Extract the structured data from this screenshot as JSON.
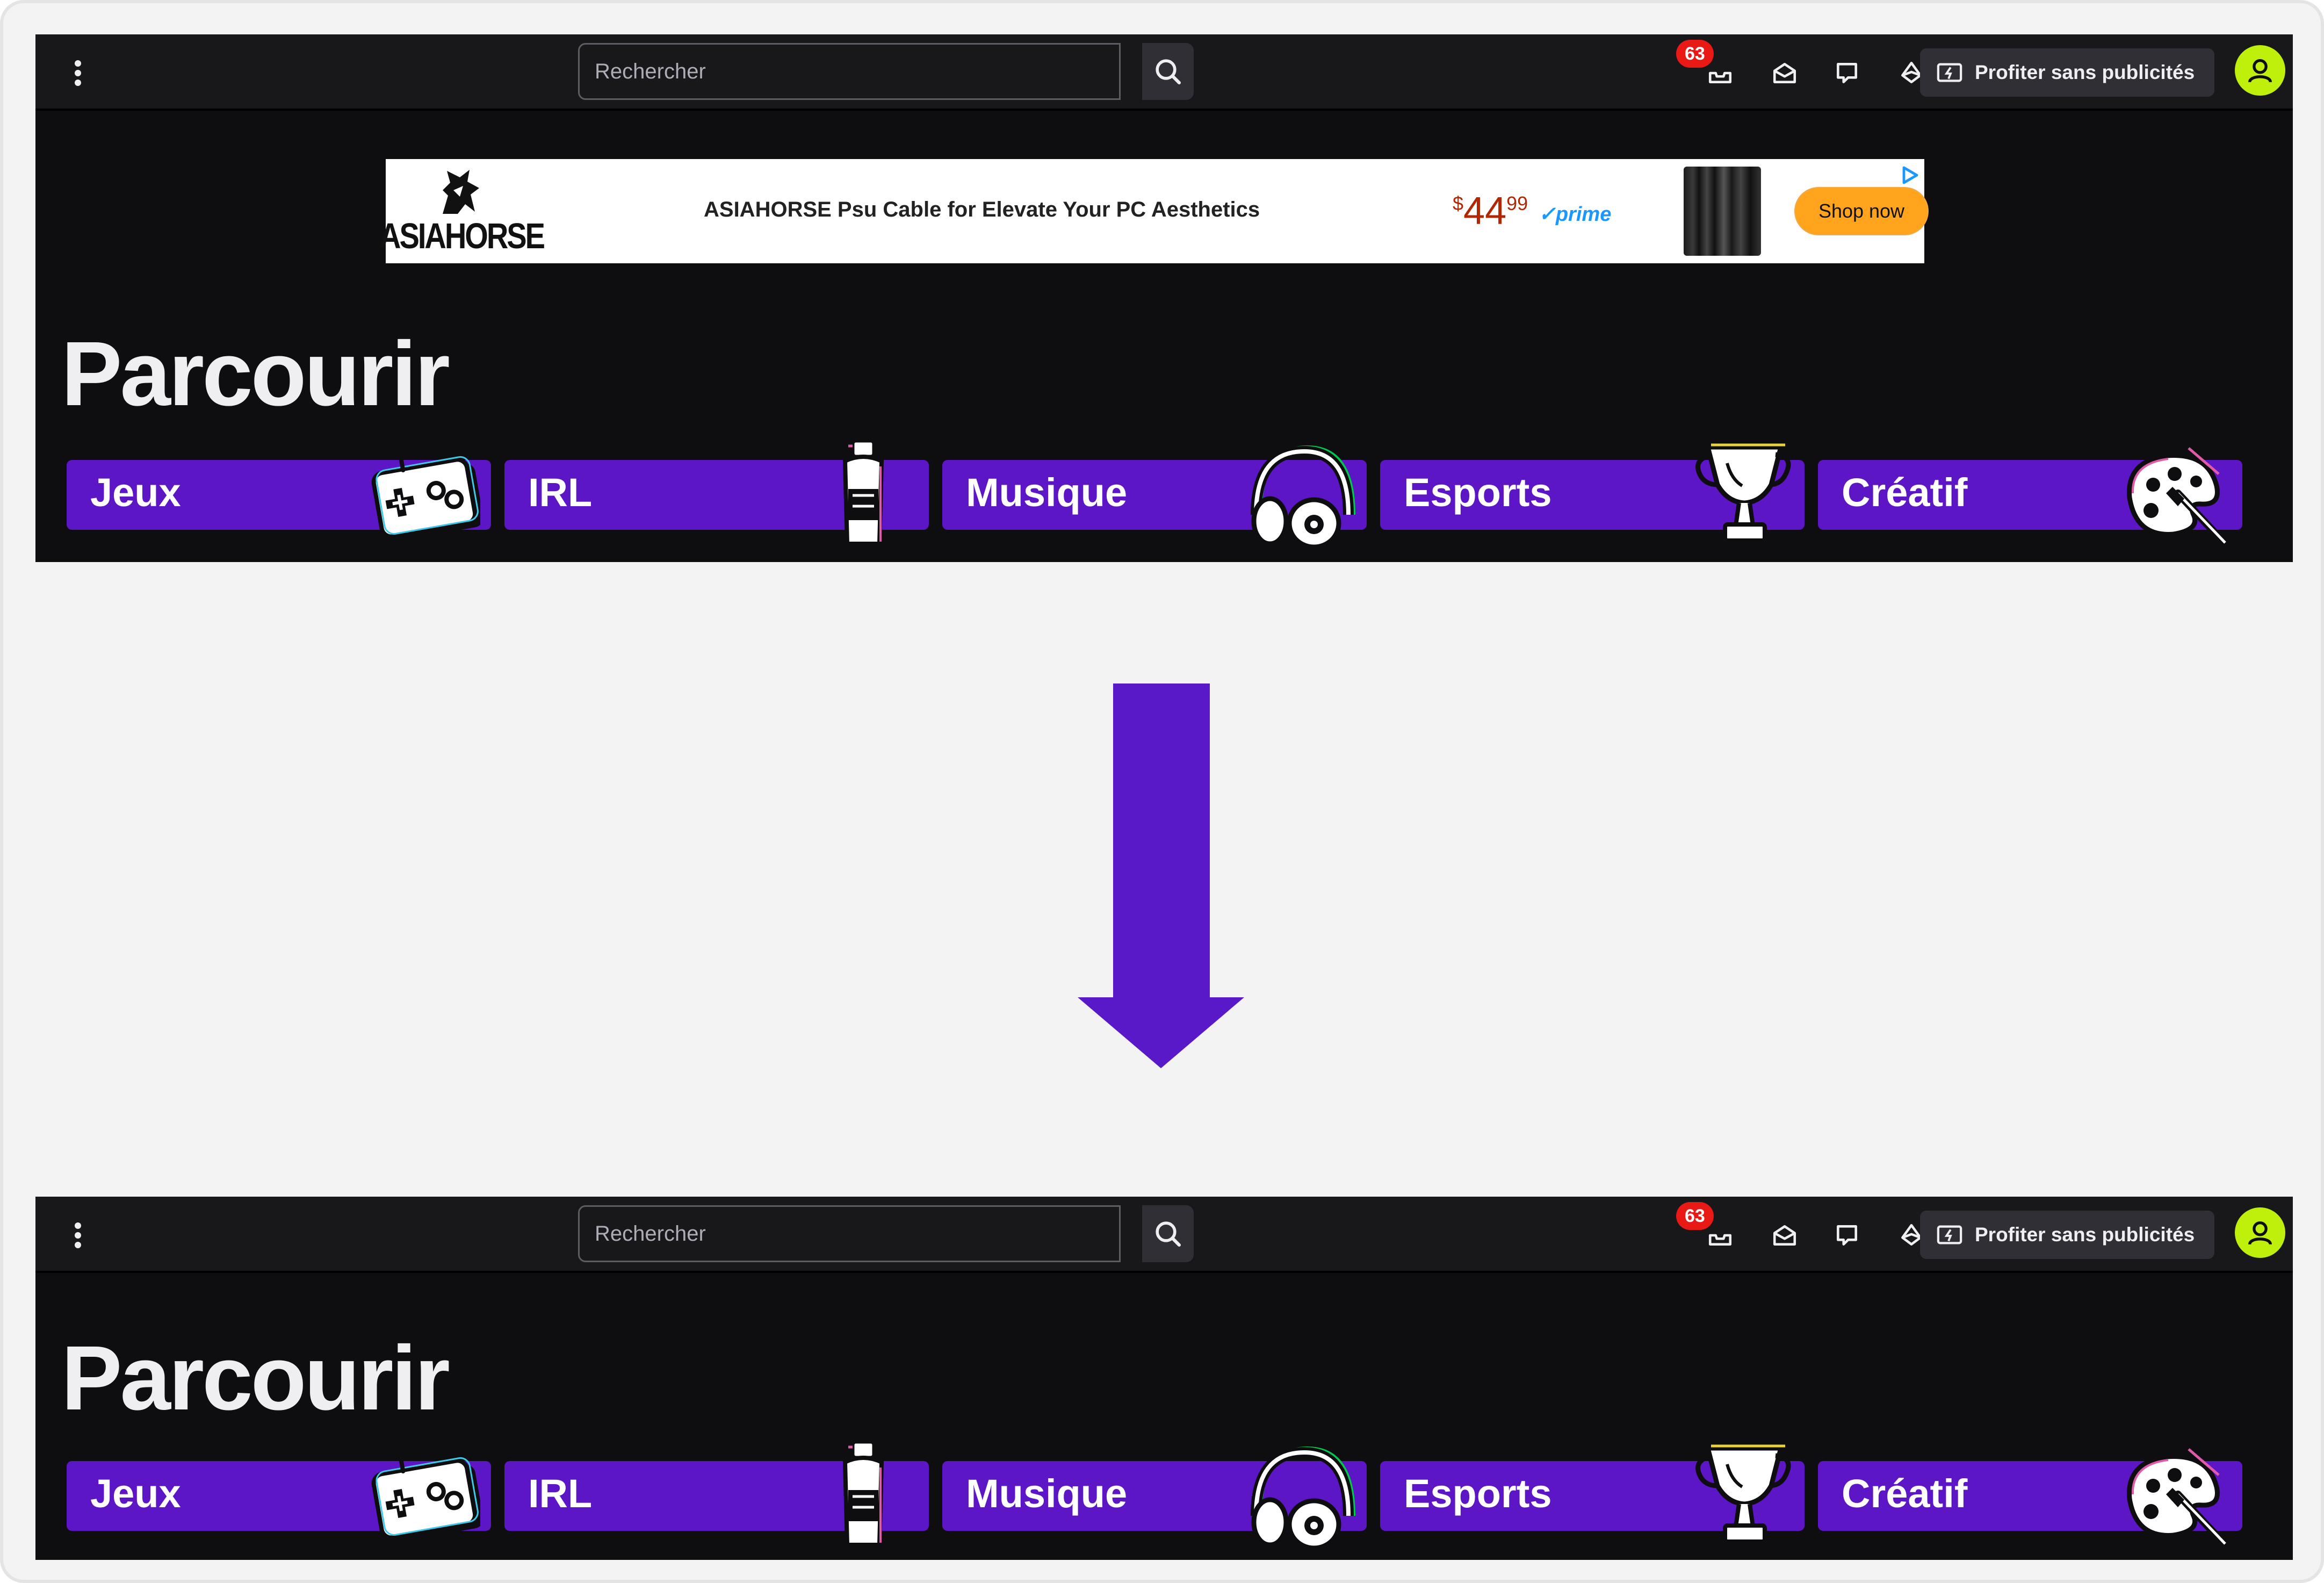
{
  "before": {
    "search": {
      "placeholder": "Rechercher"
    },
    "notifications_count": "63",
    "adfree_label": "Profiter sans publicités",
    "ad": {
      "brand": "ASIAHORSE",
      "title": "ASIAHORSE Psu Cable for Elevate Your PC Aesthetics",
      "price_currency": "$",
      "price_whole": "44",
      "price_cents": "99",
      "prime_label": "prime",
      "cta": "Shop now"
    },
    "heading": "Parcourir",
    "categories": [
      {
        "label": "Jeux",
        "icon": "gamepad-icon"
      },
      {
        "label": "IRL",
        "icon": "spray-can-icon"
      },
      {
        "label": "Musique",
        "icon": "headphones-icon"
      },
      {
        "label": "Esports",
        "icon": "trophy-icon"
      },
      {
        "label": "Créatif",
        "icon": "palette-icon"
      }
    ]
  },
  "after": {
    "search": {
      "placeholder": "Rechercher"
    },
    "notifications_count": "63",
    "adfree_label": "Profiter sans publicités",
    "heading": "Parcourir",
    "categories": [
      {
        "label": "Jeux",
        "icon": "gamepad-icon"
      },
      {
        "label": "IRL",
        "icon": "spray-can-icon"
      },
      {
        "label": "Musique",
        "icon": "headphones-icon"
      },
      {
        "label": "Esports",
        "icon": "trophy-icon"
      },
      {
        "label": "Créatif",
        "icon": "palette-icon"
      }
    ]
  },
  "colors": {
    "panel_bg": "#0e0e10",
    "nav_bg": "#18181b",
    "category_bg": "#5c16c5",
    "arrow": "#5a19c8",
    "badge": "#e91916",
    "avatar": "#bef00b",
    "cta": "#ffa41c",
    "price": "#b12704"
  },
  "arrow_icon": "arrow-down-icon"
}
